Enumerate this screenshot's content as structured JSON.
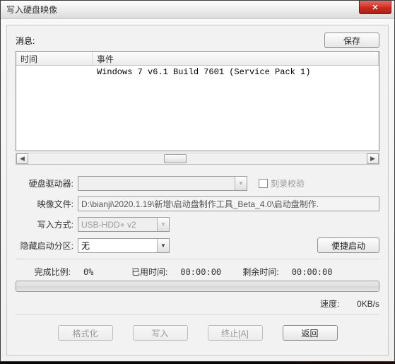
{
  "window": {
    "title": "写入硬盘映像"
  },
  "close": "✕",
  "header": {
    "message_label": "消息:",
    "save_button": "保存"
  },
  "list": {
    "columns": {
      "time": "时间",
      "event": "事件"
    },
    "rows": [
      {
        "time": "",
        "event": "Windows 7 v6.1 Build 7601 (Service Pack 1)"
      }
    ]
  },
  "form": {
    "drive_label": "硬盘驱动器:",
    "drive_value": "",
    "verify_label": "刻录校验",
    "image_label": "映像文件:",
    "image_value": "D:\\bianji\\2020.1.19\\新增\\启动盘制作工具_Beta_4.0\\启动盘制作.",
    "write_mode_label": "写入方式:",
    "write_mode_value": "USB-HDD+ v2",
    "hide_part_label": "隐藏启动分区:",
    "hide_part_value": "无",
    "quick_boot_button": "便捷启动"
  },
  "stats": {
    "done_label": "完成比例:",
    "done_value": "0%",
    "elapsed_label": "已用时间:",
    "elapsed_value": "00:00:00",
    "remain_label": "剩余时间:",
    "remain_value": "00:00:00",
    "speed_label": "速度:",
    "speed_value": "0KB/s"
  },
  "buttons": {
    "format": "格式化",
    "write": "写入",
    "abort": "终止[A]",
    "back": "返回"
  }
}
